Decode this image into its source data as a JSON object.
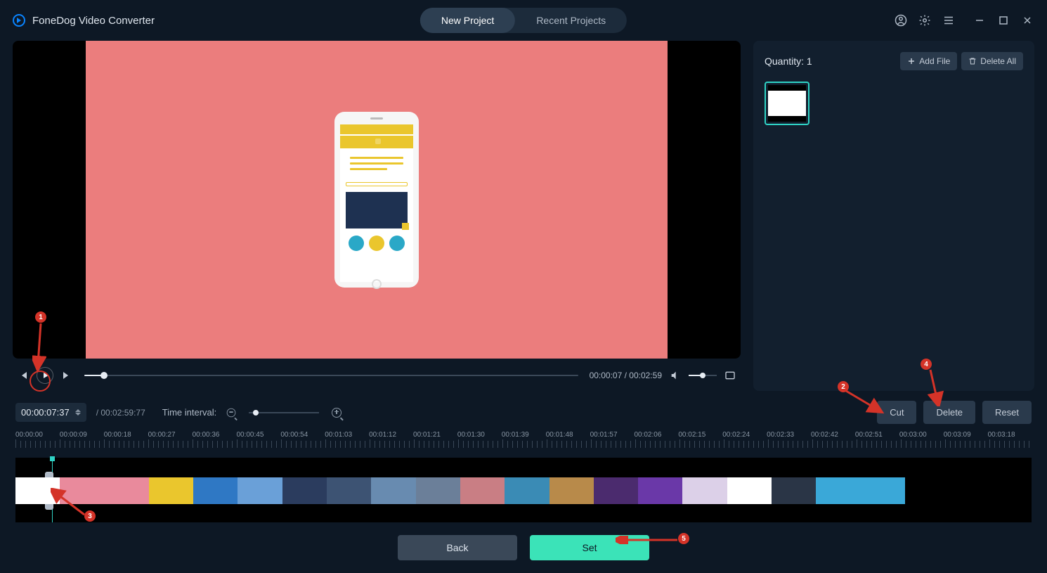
{
  "app": {
    "title": "FoneDog Video Converter"
  },
  "tabs": {
    "new_project": "New Project",
    "recent_projects": "Recent Projects"
  },
  "playback": {
    "time": "00:00:07 / 00:02:59"
  },
  "editbar": {
    "current_time": "00:00:07:37",
    "total_time": "/ 00:02:59:77",
    "interval_label": "Time interval:"
  },
  "sidebar": {
    "quantity_label": "Quantity:",
    "quantity_value": "1",
    "add_file": "Add File",
    "delete_all": "Delete All"
  },
  "actions": {
    "cut": "Cut",
    "delete": "Delete",
    "reset": "Reset"
  },
  "bottom": {
    "back": "Back",
    "set": "Set"
  },
  "ruler_labels": [
    "00:00:00",
    "00:00:09",
    "00:00:18",
    "00:00:27",
    "00:00:36",
    "00:00:45",
    "00:00:54",
    "00:01:03",
    "00:01:12",
    "00:01:21",
    "00:01:30",
    "00:01:39",
    "00:01:48",
    "00:01:57",
    "00:02:06",
    "00:02:15",
    "00:02:24",
    "00:02:33",
    "00:02:42",
    "00:02:51",
    "00:03:00",
    "00:03:09",
    "00:03:18"
  ],
  "annotations": {
    "n1": "1",
    "n2": "2",
    "n3": "3",
    "n4": "4",
    "n5": "5"
  }
}
